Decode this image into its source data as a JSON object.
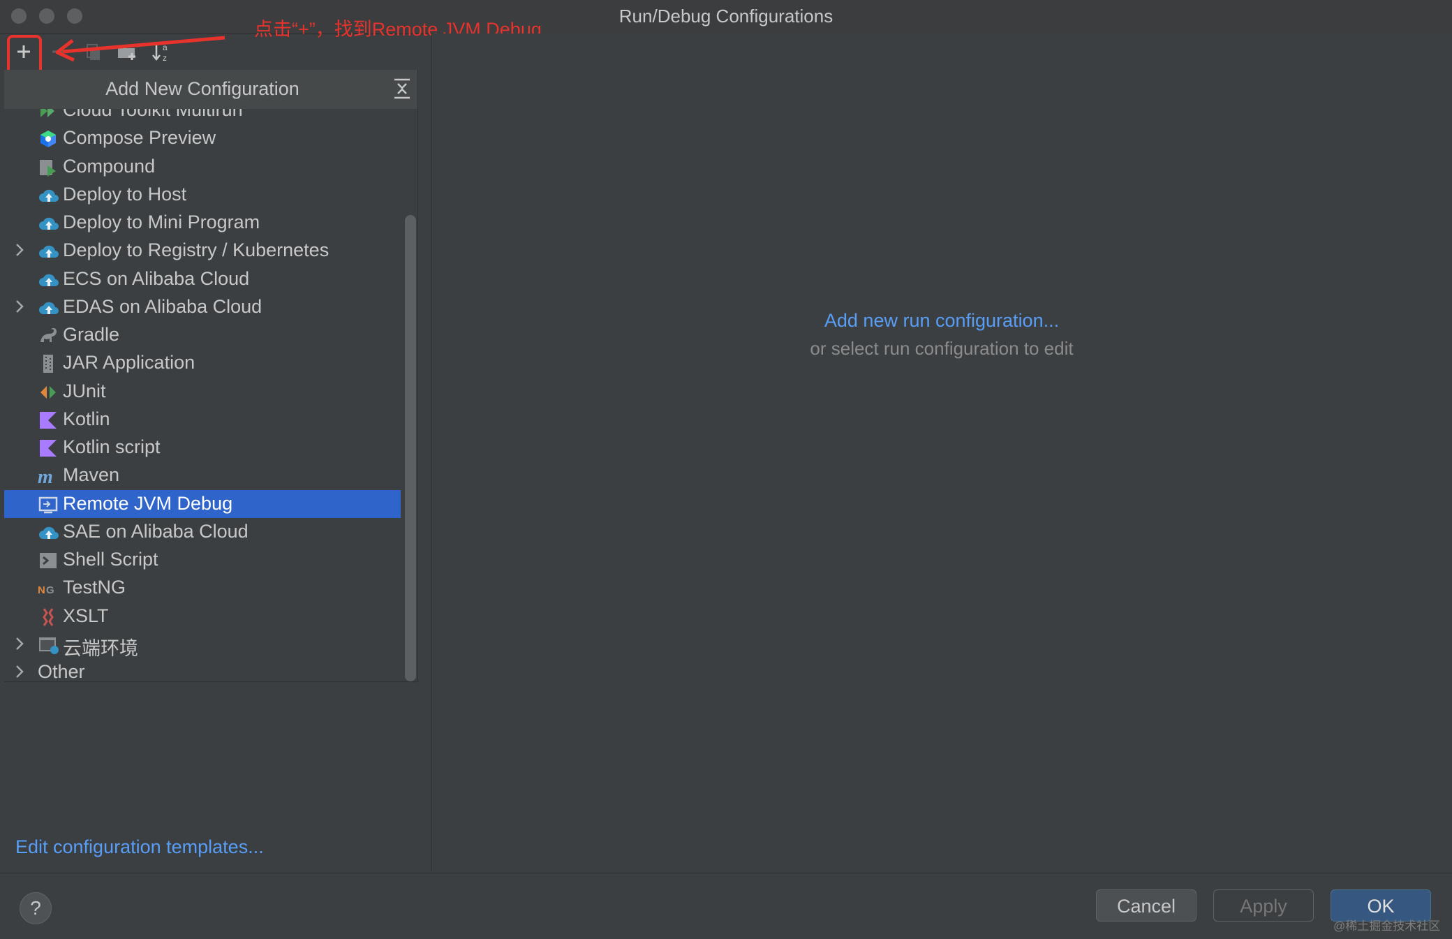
{
  "window": {
    "title": "Run/Debug Configurations"
  },
  "annotation": {
    "text": "点击“+”，找到Remote JVM Debug"
  },
  "toolbar": {
    "icons": [
      "add-icon",
      "remove-icon",
      "copy-icon",
      "new-folder-icon",
      "sort-alphabetically-icon"
    ]
  },
  "popup": {
    "title": "Add New Configuration",
    "items": [
      {
        "label": "Cloud Toolkit Multirun",
        "icon": "cloud-toolkit-multirun-icon",
        "expandable": false
      },
      {
        "label": "Compose Preview",
        "icon": "compose-preview-icon",
        "expandable": false
      },
      {
        "label": "Compound",
        "icon": "compound-icon",
        "expandable": false
      },
      {
        "label": "Deploy to Host",
        "icon": "alibaba-cloud-icon",
        "expandable": false
      },
      {
        "label": "Deploy to Mini Program",
        "icon": "alibaba-cloud-icon",
        "expandable": false
      },
      {
        "label": "Deploy to Registry / Kubernetes",
        "icon": "alibaba-cloud-icon",
        "expandable": true
      },
      {
        "label": "ECS on Alibaba Cloud",
        "icon": "alibaba-cloud-icon",
        "expandable": false
      },
      {
        "label": "EDAS on Alibaba Cloud",
        "icon": "alibaba-cloud-icon",
        "expandable": true
      },
      {
        "label": "Gradle",
        "icon": "gradle-icon",
        "expandable": false
      },
      {
        "label": "JAR Application",
        "icon": "jar-application-icon",
        "expandable": false
      },
      {
        "label": "JUnit",
        "icon": "junit-icon",
        "expandable": false
      },
      {
        "label": "Kotlin",
        "icon": "kotlin-icon",
        "expandable": false
      },
      {
        "label": "Kotlin script",
        "icon": "kotlin-icon",
        "expandable": false
      },
      {
        "label": "Maven",
        "icon": "maven-icon",
        "expandable": false
      },
      {
        "label": "Remote JVM Debug",
        "icon": "remote-jvm-debug-icon",
        "expandable": false,
        "selected": true
      },
      {
        "label": "SAE on Alibaba Cloud",
        "icon": "alibaba-cloud-icon",
        "expandable": false
      },
      {
        "label": "Shell Script",
        "icon": "shell-script-icon",
        "expandable": false
      },
      {
        "label": "TestNG",
        "icon": "testng-icon",
        "expandable": false
      },
      {
        "label": "XSLT",
        "icon": "xslt-icon",
        "expandable": false
      },
      {
        "label": "云端环境",
        "icon": "cloud-environment-icon",
        "expandable": true
      },
      {
        "label": "Other",
        "icon": "",
        "expandable": true
      }
    ]
  },
  "main": {
    "add_link": "Add new run configuration...",
    "hint": "or select run configuration to edit"
  },
  "footer": {
    "edit_templates": "Edit configuration templates...",
    "help": "?",
    "cancel": "Cancel",
    "apply": "Apply",
    "ok": "OK"
  },
  "watermark": "@稀土掘金技术社区",
  "colors": {
    "background": "#3c3f41",
    "selection": "#2f65ca",
    "link": "#589df6",
    "annotation": "#e8322c",
    "ok_button": "#365880"
  }
}
